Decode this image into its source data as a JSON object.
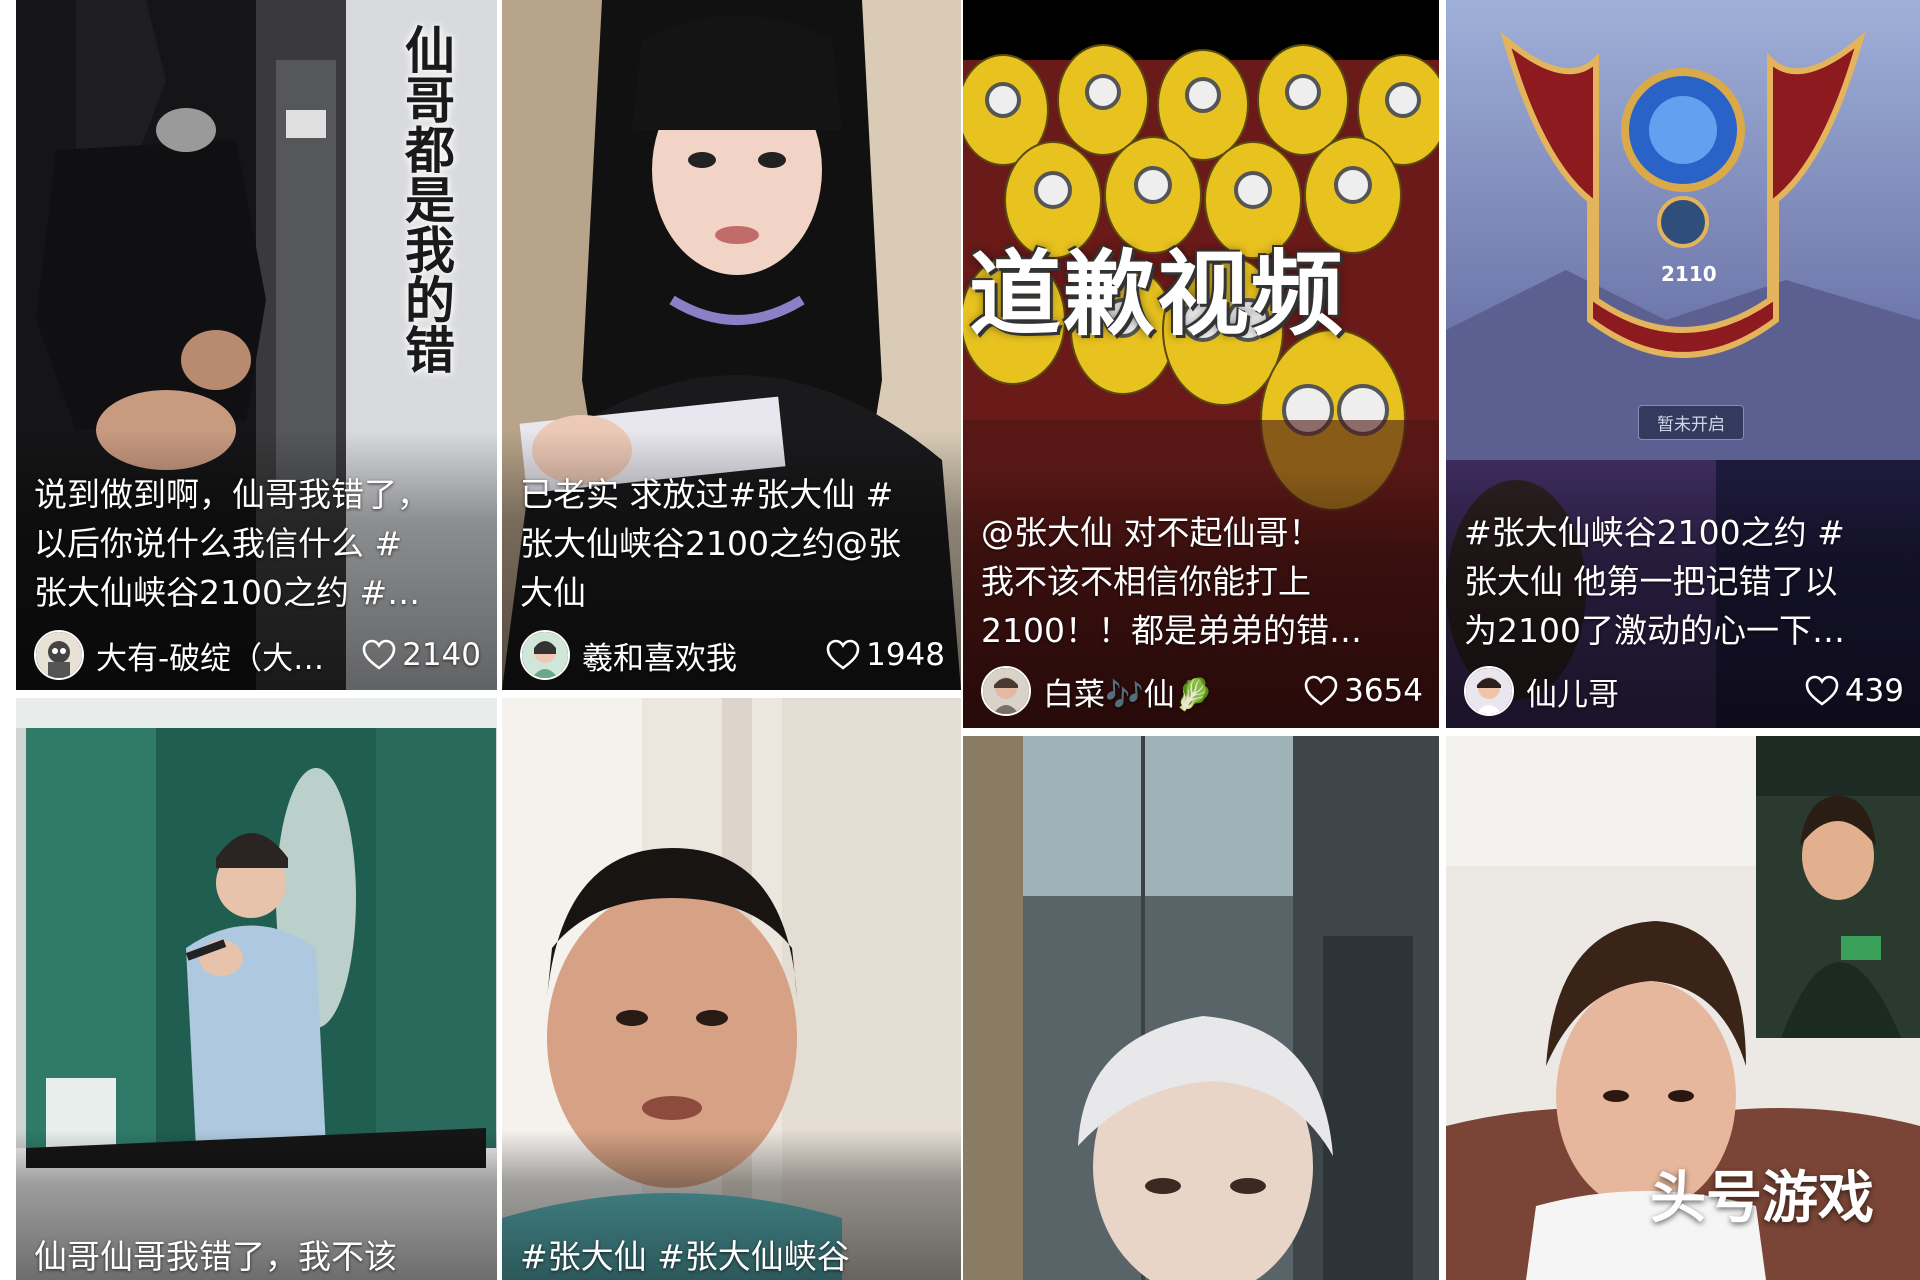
{
  "cards": [
    {
      "overlay_text": "仙哥都是我的错",
      "caption_lines": [
        "说到做到啊，仙哥我错了，",
        "以后你说什么我信什么 #",
        "张大仙峡谷2100之约 #…"
      ],
      "author": "大有-破绽（大…",
      "likes": "2140"
    },
    {
      "caption_lines": [
        "已老实 求放过#张大仙 #",
        "张大仙峡谷2100之约@张",
        "大仙"
      ],
      "author": "羲和喜欢我",
      "likes": "1948"
    },
    {
      "overlay_text": "道歉视频",
      "caption_lines": [
        "@张大仙 对不起仙哥！",
        "我不该不相信你能打上",
        "2100！！都是弟弟的错…"
      ],
      "author": "白菜🎶仙🥬",
      "likes": "3654"
    },
    {
      "rank_value": "2110",
      "rank_button": "暂未开启",
      "caption_lines": [
        "#张大仙峡谷2100之约 #",
        "张大仙 他第一把记错了以",
        "为2100了激动的心一下…"
      ],
      "author": "仙儿哥",
      "likes": "439"
    },
    {
      "caption_lines": [
        "仙哥仙哥我错了，我不该"
      ]
    },
    {
      "caption_lines": [
        "#张大仙 #张大仙峡谷"
      ]
    },
    {
      "caption_lines": []
    },
    {
      "caption_lines": []
    }
  ],
  "watermark": "头号游戏",
  "icons": {
    "like": "heart-icon"
  },
  "colors": {
    "background": "#ffffff",
    "text": "#ffffff"
  }
}
